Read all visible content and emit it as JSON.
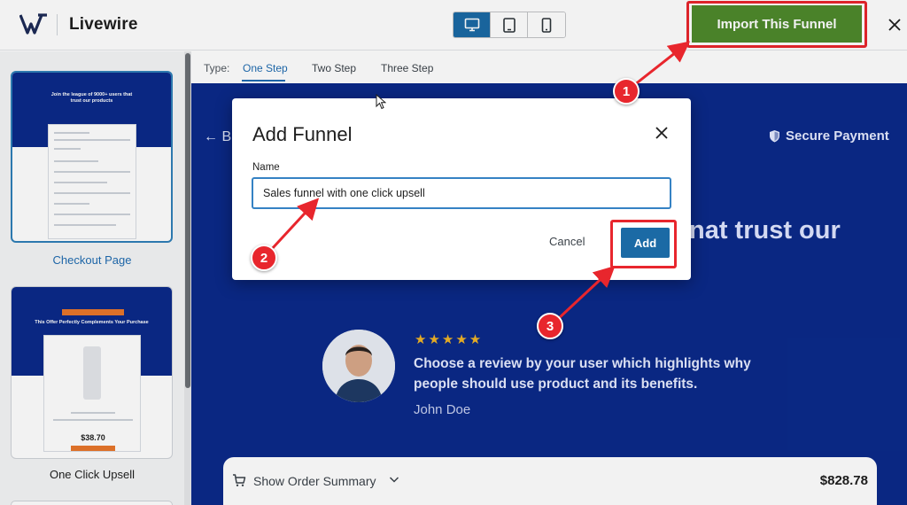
{
  "header": {
    "brand_name": "Livewire",
    "import_label": "Import This Funnel",
    "devices": [
      "desktop-icon",
      "tablet-icon",
      "mobile-icon"
    ],
    "active_device": "desktop"
  },
  "tabs": {
    "type_label": "Type:",
    "items": [
      "One Step",
      "Two Step",
      "Three Step"
    ],
    "active": "One Step"
  },
  "sidebar": {
    "items": [
      {
        "label": "Checkout Page",
        "active": true
      },
      {
        "label": "One Click Upsell",
        "active": false
      }
    ],
    "thumb1_text": "Join the league of 9000+ users that trust our products",
    "thumb2_text": "This Offer Perfectly Complements Your Purchase",
    "thumb2_price": "$38.70"
  },
  "preview": {
    "back_label": "B",
    "secure_label": "Secure Payment",
    "hero_fragment": "nat trust our",
    "stars": "★★★★★",
    "review": "Choose a review by your user which highlights why people should use product and its benefits.",
    "reviewer": "John Doe",
    "summary_label": "Show Order Summary",
    "summary_price": "$828.78"
  },
  "modal": {
    "title": "Add Funnel",
    "name_label": "Name",
    "name_value": "Sales funnel with one click upsell",
    "cancel_label": "Cancel",
    "add_label": "Add"
  },
  "annotations": {
    "steps": [
      "1",
      "2",
      "3"
    ],
    "color": "#e8262d"
  },
  "colors": {
    "accent": "#1b6aa5",
    "import_green": "#4e8a2c",
    "preview_blue": "#0b2a8a"
  }
}
